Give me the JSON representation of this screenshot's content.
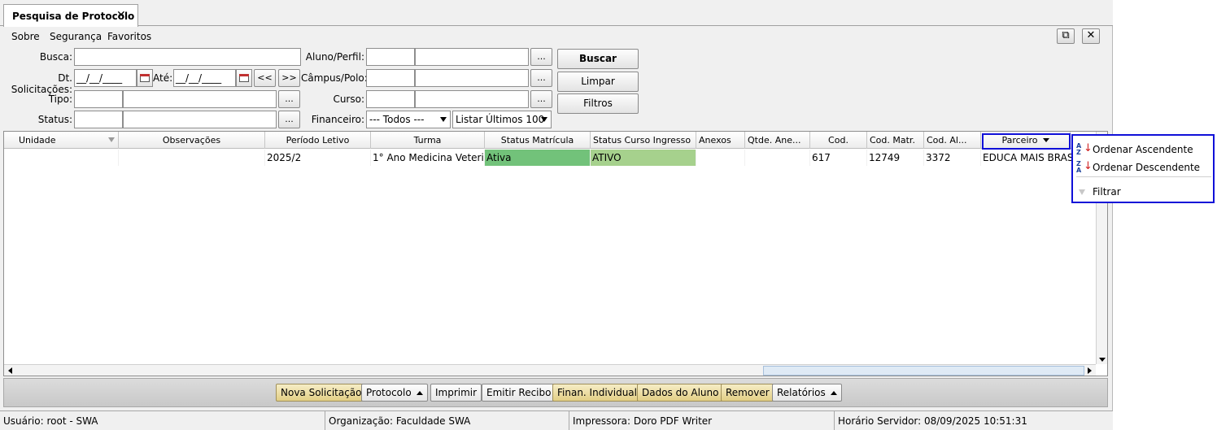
{
  "tab": {
    "title": "Pesquisa de Protocolo",
    "close_glyph": "✕"
  },
  "menu": {
    "items": [
      "Sobre",
      "Segurança",
      "Favoritos"
    ]
  },
  "window_buttons": {
    "popout_glyph": "⧉",
    "close_glyph": "✕"
  },
  "form": {
    "busca_label": "Busca:",
    "busca_value": "",
    "dt_label": "Dt. Solicitações:",
    "dt_from": "__/__/____",
    "ate_label": "Até:",
    "dt_to": "__/__/____",
    "prev_label": "<<",
    "next_label": ">>",
    "tipo_label": "Tipo:",
    "status_label": "Status:",
    "aluno_label": "Aluno/Perfil:",
    "campus_label": "Câmpus/Polo:",
    "curso_label": "Curso:",
    "financeiro_label": "Financeiro:",
    "financeiro_value": "--- Todos ---",
    "listar_value": "Listar Últimos 100",
    "ellipsis": "...",
    "buscar": "Buscar",
    "limpar": "Limpar",
    "filtros": "Filtros"
  },
  "grid": {
    "columns": [
      "Unidade",
      "Observações",
      "Período Letivo",
      "Turma",
      "Status Matrícula",
      "Status Curso Ingresso",
      "Anexos",
      "Qtde. Ane...",
      "Cod.",
      "Cod. Matr.",
      "Cod. Al...",
      "Parceiro"
    ],
    "rows": [
      [
        "",
        "",
        "2025/2",
        "1°  Ano Medicina Veteri...",
        "Ativa",
        "ATIVO",
        "",
        "",
        "617",
        "12749",
        "3372",
        "EDUCA MAIS BRASIL"
      ]
    ],
    "status_colors": {
      "ativa": "#72c27a",
      "ativo": "#a6d18d"
    }
  },
  "context_menu": {
    "asc": "Ordenar Ascendente",
    "desc": "Ordenar Descendente",
    "filter": "Filtrar",
    "az_top": "A",
    "az_bottom": "Z",
    "arrow": "↓"
  },
  "toolbar": {
    "nova": "Nova Solicitação",
    "protocolo": "Protocolo",
    "imprimir": "Imprimir",
    "emitir": "Emitir Recibo",
    "finan": "Finan. Individual",
    "dados": "Dados do Aluno",
    "remover": "Remover",
    "relatorios": "Relatórios"
  },
  "status_bar": {
    "usuario": "Usuário: root - SWA",
    "organizacao": "Organização: Faculdade SWA",
    "impressora": "Impressora: Doro PDF Writer",
    "horario": "Horário Servidor: 08/09/2025 10:51:31"
  },
  "colors": {
    "highlight": "#1010d8",
    "toolbar_yellow": "#e3cf85"
  }
}
